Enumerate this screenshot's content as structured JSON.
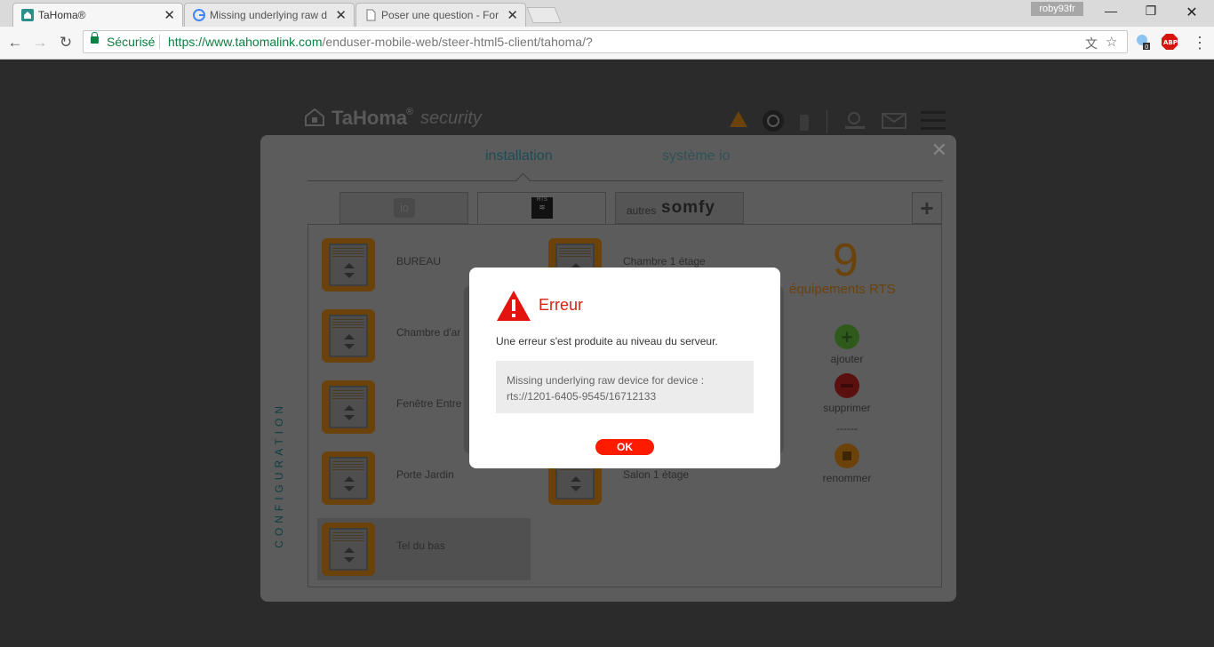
{
  "browser": {
    "tabs": [
      {
        "title": "TaHoma®",
        "favicon": "tahoma-icon",
        "active": true
      },
      {
        "title": "Missing underlying raw d",
        "favicon": "google-icon",
        "active": false
      },
      {
        "title": "Poser une question - For",
        "favicon": "page-icon",
        "active": false
      }
    ],
    "profile_name": "roby93fr",
    "secure_label": "Sécurisé",
    "url_host": "https://www.tahomalink.com",
    "url_path": "/enduser-mobile-web/steer-html5-client/tahoma/?",
    "extension_badge": "0",
    "abp_label": "ABP"
  },
  "app": {
    "logo_text": "TaHoma",
    "logo_reg": "®",
    "logo_sub": "security",
    "tabs": {
      "installation": "installation",
      "system_io": "système io"
    },
    "protocol_tabs": {
      "io": "io",
      "rts": "RTS",
      "others_prefix": "autres",
      "others_brand": "somfy"
    },
    "side_label": "CONFIGURATION",
    "devices_col1": [
      "BUREAU",
      "Chambre d'ar",
      "Fenêtre Entre",
      "Porte Jardin",
      "Tel du bas"
    ],
    "devices_col2": [
      "Chambre 1 étage",
      "Salon 1 étage"
    ],
    "count": "9",
    "count_label": "équipements RTS",
    "actions": {
      "add": "ajouter",
      "remove": "supprimer",
      "separator": "------",
      "rename": "renommer"
    }
  },
  "dialog": {
    "title": "Erreur",
    "message": "Une erreur s'est produite au niveau du serveur.",
    "detail_line1": "Missing underlying raw device for device :",
    "detail_line2": "rts://1201-6405-9545/16712133",
    "ok_label": "OK"
  },
  "colors": {
    "accent_red": "#d9230f",
    "ok_button": "#ff1b00",
    "secure_green": "#0b8043"
  }
}
